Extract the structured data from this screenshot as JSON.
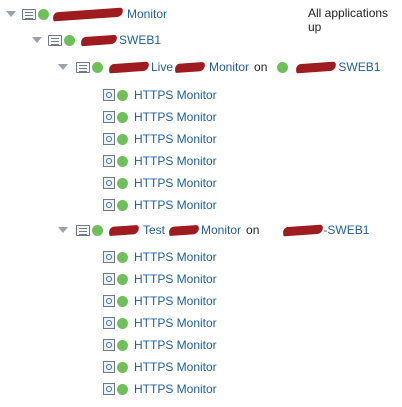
{
  "header": {
    "status_text": "All applications up"
  },
  "root": {
    "label": "Monitor"
  },
  "server": {
    "label": "SWEB1"
  },
  "groups": [
    {
      "prefix": "Live",
      "middle": "Monitor",
      "on": "on",
      "host": "SWEB1",
      "items": [
        "HTTPS Monitor",
        "HTTPS Monitor",
        "HTTPS Monitor",
        "HTTPS Monitor",
        "HTTPS Monitor",
        "HTTPS Monitor"
      ]
    },
    {
      "prefix": "Test",
      "middle": "Monitor",
      "on": "on",
      "host": "-SWEB1",
      "items": [
        "HTTPS Monitor",
        "HTTPS Monitor",
        "HTTPS Monitor",
        "HTTPS Monitor",
        "HTTPS Monitor",
        "HTTPS Monitor",
        "HTTPS Monitor"
      ]
    }
  ],
  "colors": {
    "link": "#1f5f9f",
    "status_up": "#6fbf5b",
    "redaction": "#9e1b1f"
  }
}
